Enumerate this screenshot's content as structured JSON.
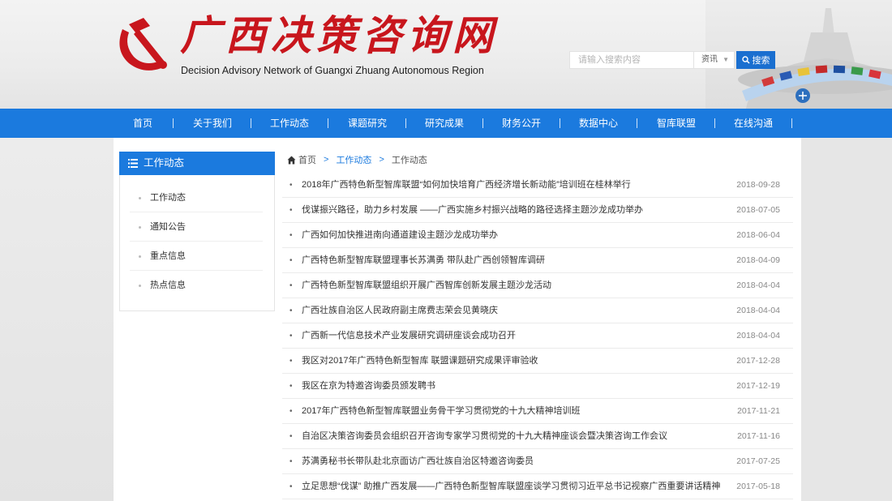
{
  "header": {
    "logo_title": "广西决策咨询网",
    "logo_subtitle": "Decision Advisory Network of Guangxi Zhuang Autonomous Region",
    "search_placeholder": "请输入搜索内容",
    "search_category": "资讯",
    "search_button_label": "搜索"
  },
  "nav": {
    "items": [
      {
        "label": "首页"
      },
      {
        "label": "关于我们"
      },
      {
        "label": "工作动态"
      },
      {
        "label": "课题研究"
      },
      {
        "label": "研究成果"
      },
      {
        "label": "财务公开"
      },
      {
        "label": "数据中心"
      },
      {
        "label": "智库联盟"
      },
      {
        "label": "在线沟通"
      }
    ]
  },
  "sidebar": {
    "title": "工作动态",
    "items": [
      {
        "label": "工作动态"
      },
      {
        "label": "通知公告"
      },
      {
        "label": "重点信息"
      },
      {
        "label": "热点信息"
      }
    ]
  },
  "breadcrumb": {
    "home": "首页",
    "level1": "工作动态",
    "level2": "工作动态",
    "separator": ">"
  },
  "articles": [
    {
      "title": "2018年广西特色新型智库联盟“如何加快培育广西经济增长新动能”培训班在桂林举行",
      "date": "2018-09-28"
    },
    {
      "title": "伐谋振兴路径，助力乡村发展 ——广西实施乡村振兴战略的路径选择主题沙龙成功举办",
      "date": "2018-07-05"
    },
    {
      "title": "广西如何加快推进南向通道建设主题沙龙成功举办",
      "date": "2018-06-04"
    },
    {
      "title": "广西特色新型智库联盟理事长苏满勇 带队赴广西创领智库调研",
      "date": "2018-04-09"
    },
    {
      "title": "广西特色新型智库联盟组织开展广西智库创新发展主题沙龙活动",
      "date": "2018-04-04"
    },
    {
      "title": "广西壮族自治区人民政府副主席费志荣会见黄晓庆",
      "date": "2018-04-04"
    },
    {
      "title": "广西新一代信息技术产业发展研究调研座谈会成功召开",
      "date": "2018-04-04"
    },
    {
      "title": "我区对2017年广西特色新型智库 联盟课题研究成果评审验收",
      "date": "2017-12-28"
    },
    {
      "title": "我区在京为特邀咨询委员颁发聘书",
      "date": "2017-12-19"
    },
    {
      "title": "2017年广西特色新型智库联盟业务骨干学习贯彻党的十九大精神培训班",
      "date": "2017-11-21"
    },
    {
      "title": "自治区决策咨询委员会组织召开咨询专家学习贯彻党的十九大精神座谈会暨决策咨询工作会议",
      "date": "2017-11-16"
    },
    {
      "title": "苏满勇秘书长带队赴北京面访广西壮族自治区特邀咨询委员",
      "date": "2017-07-25"
    },
    {
      "title": "立足思想“伐谋” 助推广西发展——广西特色新型智库联盟座谈学习贯彻习近平总书记视察广西重要讲话精神",
      "date": "2017-05-18"
    }
  ],
  "icons": {
    "emblem": "hammer-sickle-icon",
    "search": "search-icon",
    "menu": "menu-icon",
    "home": "home-icon",
    "bullet": "bullet-icon"
  },
  "colors": {
    "brand_red": "#c8161d",
    "nav_blue": "#1b7ade",
    "button_blue": "#1a6fd0"
  }
}
